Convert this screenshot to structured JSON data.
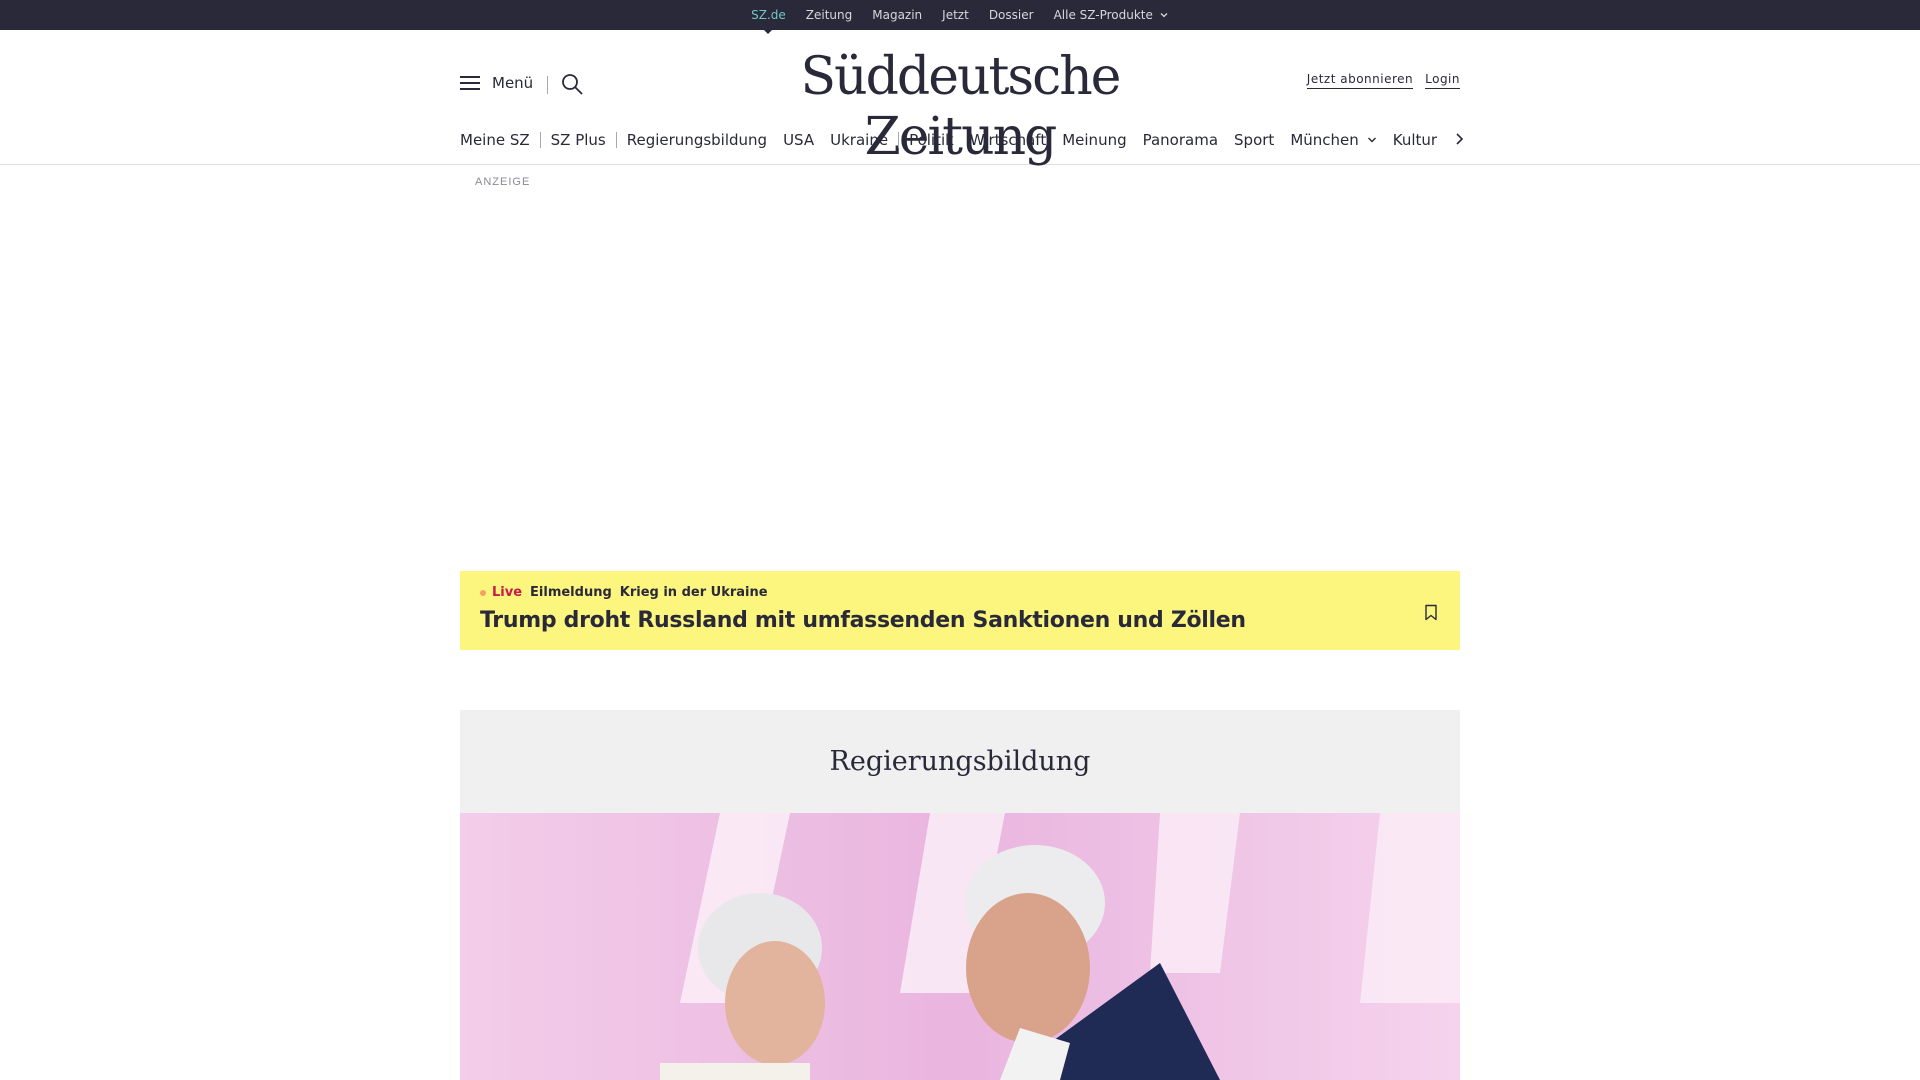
{
  "topbar": {
    "links": [
      {
        "label": "SZ.de",
        "active": true
      },
      {
        "label": "Zeitung"
      },
      {
        "label": "Magazin"
      },
      {
        "label": "Jetzt"
      },
      {
        "label": "Dossier"
      },
      {
        "label": "Alle SZ-Produkte",
        "dropdown": true
      }
    ]
  },
  "masthead": {
    "menu_label": "Menü",
    "logo_text": "Süddeutsche Zeitung",
    "subscribe_label": "Jetzt abonnieren",
    "login_label": "Login"
  },
  "nav": {
    "items": [
      "Meine SZ",
      "SZ Plus",
      "Regierungsbildung",
      "USA",
      "Ukraine",
      "Politik",
      "Wirtschaft",
      "Meinung",
      "Panorama",
      "Sport",
      "München",
      "Kultur"
    ]
  },
  "ad": {
    "label": "ANZEIGE"
  },
  "breaking": {
    "live_label": "Live",
    "kicker": "Eilmeldung",
    "topic": "Krieg in der Ukraine",
    "title": "Trump droht Russland mit umfassenden Sanktionen und Zöllen"
  },
  "section": {
    "title": "Regierungsbildung"
  },
  "colors": {
    "topbar": "#29293a",
    "active_link": "#71c5c7",
    "breaking_bg": "#fcf67f",
    "live": "#c9184a",
    "section_bg": "#f0f0f0"
  }
}
